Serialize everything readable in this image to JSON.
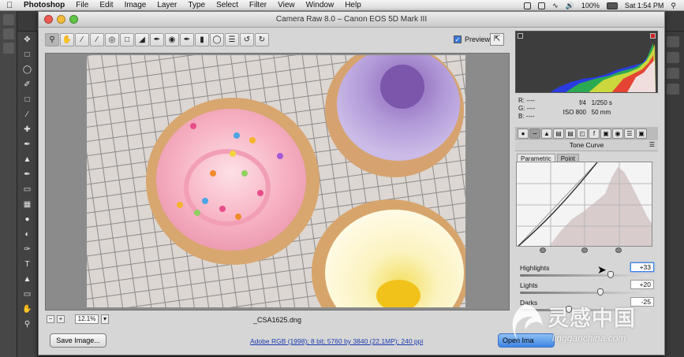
{
  "menubar": {
    "app_name": "Photoshop",
    "menus": [
      "File",
      "Edit",
      "Image",
      "Layer",
      "Type",
      "Select",
      "Filter",
      "View",
      "Window",
      "Help"
    ],
    "battery": "100%",
    "clock": "Sat 1:54 PM"
  },
  "window": {
    "title": "Camera Raw 8.0  –  Canon EOS 5D Mark III"
  },
  "toolbar": {
    "tools": [
      "zoom-icon",
      "hand-icon",
      "white-balance-icon",
      "color-sampler-icon",
      "target-adjust-icon",
      "crop-icon",
      "straighten-icon",
      "spot-removal-icon",
      "red-eye-icon",
      "adjustment-brush-icon",
      "graduated-filter-icon",
      "radial-filter-icon",
      "preferences-icon",
      "rotate-ccw-icon",
      "rotate-cw-icon"
    ],
    "preview_label": "Preview",
    "preview_checked": true
  },
  "canvas": {
    "zoom_value": "12.1%",
    "filename": "_CSA1625.dng"
  },
  "bottom": {
    "save_label": "Save Image...",
    "workflow_link": "Adobe RGB (1998); 8 bit; 5760 by 3840 (22.1MP); 240 ppi",
    "open_label": "Open Ima"
  },
  "readout": {
    "r_label": "R:",
    "g_label": "G:",
    "b_label": "B:",
    "rgb_value": "----",
    "aperture": "f/4",
    "shutter": "1/250 s",
    "iso": "ISO 800",
    "focal": "50 mm"
  },
  "panel": {
    "title": "Tone Curve",
    "subtabs": [
      "Parametric",
      "Point"
    ],
    "active_subtab": "Parametric",
    "sliders": [
      {
        "label": "Highlights",
        "value": "+33",
        "fraction": 0.7
      },
      {
        "label": "Lights",
        "value": "+20",
        "fraction": 0.62
      },
      {
        "label": "Darks",
        "value": "-25",
        "fraction": 0.38
      }
    ]
  },
  "colors": {
    "accent": "#3b7fe0",
    "link": "#1a3bb0"
  },
  "watermark": {
    "title": "灵感中国",
    "url": "lingganchina.com"
  }
}
